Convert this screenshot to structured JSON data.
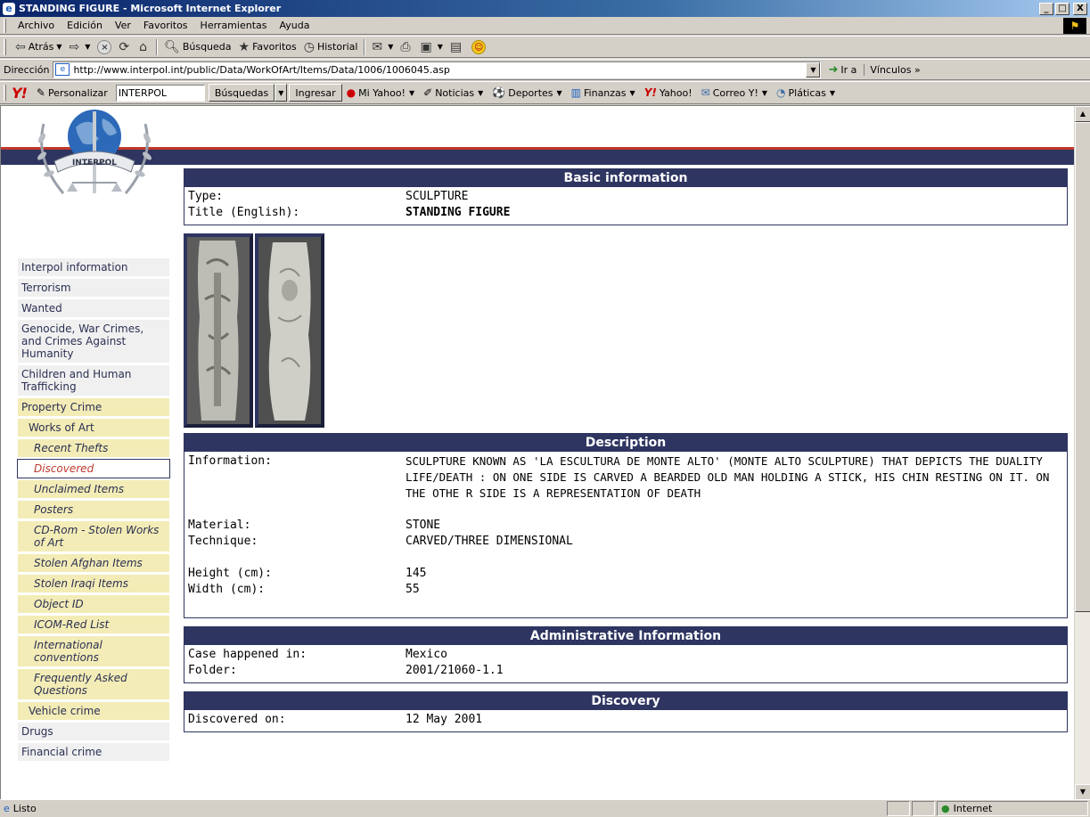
{
  "window": {
    "title": "STANDING FIGURE - Microsoft Internet Explorer",
    "min": "_",
    "max": "□",
    "close": "X"
  },
  "menu": [
    "Archivo",
    "Edición",
    "Ver",
    "Favoritos",
    "Herramientas",
    "Ayuda"
  ],
  "toolbar": {
    "back": "Atrás",
    "search": "Búsqueda",
    "favorites": "Favoritos",
    "history": "Historial"
  },
  "address": {
    "label": "Dirección",
    "url": "http://www.interpol.int/public/Data/WorkOfArt/Items/Data/1006/1006045.asp",
    "go": "Ir a",
    "links": "Vínculos »"
  },
  "yahoo": {
    "logo": "Y!",
    "personalize": "Personalizar",
    "search_value": "INTERPOL",
    "search_btn": "Búsquedas",
    "signin": "Ingresar",
    "myyahoo": "Mi Yahoo!",
    "news": "Noticias",
    "sports": "Deportes",
    "finance": "Finanzas",
    "yahoo": "Yahoo!",
    "mail": "Correo Y!",
    "chat": "Pláticas"
  },
  "logo_text": "INTERPOL",
  "sidebar": [
    {
      "label": "Interpol information",
      "style": "g"
    },
    {
      "label": "Terrorism",
      "style": "g"
    },
    {
      "label": "Wanted",
      "style": "g"
    },
    {
      "label": "Genocide, War Crimes, and Crimes Against Humanity",
      "style": "g"
    },
    {
      "label": "Children and Human Trafficking",
      "style": "g"
    },
    {
      "label": "Property Crime",
      "style": "y"
    },
    {
      "label": "Works of Art",
      "style": "y sub"
    },
    {
      "label": "Recent Thefts",
      "style": "y sub2"
    },
    {
      "label": "Discovered",
      "style": "active sub2"
    },
    {
      "label": "Unclaimed Items",
      "style": "y sub2"
    },
    {
      "label": "Posters",
      "style": "y sub2"
    },
    {
      "label": "CD-Rom - Stolen Works of Art",
      "style": "y sub2"
    },
    {
      "label": "Stolen Afghan Items",
      "style": "y sub2"
    },
    {
      "label": "Stolen Iraqi Items",
      "style": "y sub2"
    },
    {
      "label": "Object ID",
      "style": "y sub2"
    },
    {
      "label": "ICOM-Red List",
      "style": "y sub2"
    },
    {
      "label": "International conventions",
      "style": "y sub2"
    },
    {
      "label": "Frequently Asked Questions",
      "style": "y sub2"
    },
    {
      "label": "Vehicle crime",
      "style": "y sub"
    },
    {
      "label": "Drugs",
      "style": "g"
    },
    {
      "label": "Financial crime",
      "style": "g"
    }
  ],
  "basic": {
    "header": "Basic information",
    "type_label": "Type:",
    "type_value": "SCULPTURE",
    "title_label": "Title (English):",
    "title_value": "STANDING FIGURE"
  },
  "description": {
    "header": "Description",
    "info_label": "Information:",
    "info_value": "SCULPTURE KNOWN AS 'LA ESCULTURA DE MONTE ALTO' (MONTE ALTO SCULPTURE) THAT DEPICTS THE DUALITY LIFE/DEATH : ON ONE SIDE IS CARVED A BEARDED OLD MAN HOLDING A STICK, HIS CHIN RESTING ON IT. ON THE OTHE R SIDE IS A REPRESENTATION OF DEATH",
    "material_label": "Material:",
    "material_value": "STONE",
    "technique_label": "Technique:",
    "technique_value": "CARVED/THREE DIMENSIONAL",
    "height_label": "Height (cm):",
    "height_value": "145",
    "width_label": "Width (cm):",
    "width_value": "55"
  },
  "admin": {
    "header": "Administrative Information",
    "case_label": "Case happened in:",
    "case_value": "Mexico",
    "folder_label": "Folder:",
    "folder_value": "2001/21060-1.1"
  },
  "discovery": {
    "header": "Discovery",
    "date_label": "Discovered on:",
    "date_value": "12 May 2001"
  },
  "status": {
    "text": "Listo",
    "zone": "Internet"
  },
  "colors": {
    "navy": "#2e3561",
    "red": "#c0392b",
    "property_crime_bg": "#f3ecb6"
  }
}
